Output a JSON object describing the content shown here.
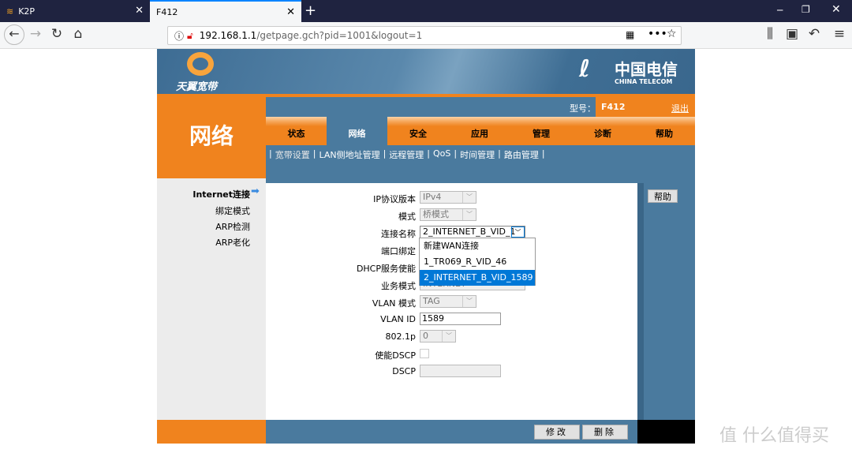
{
  "browser": {
    "tabs": [
      {
        "label": "K2P"
      },
      {
        "label": "F412",
        "active": true
      }
    ],
    "url_host": "192.168.1.1",
    "url_path": "/getpage.gch?pid=1001&logout=1"
  },
  "header": {
    "left_logo": "天翼宽带",
    "right_logo_cn": "中国电信",
    "right_logo_en": "CHINA TELECOM",
    "section_title": "网络",
    "model_label": "型号：",
    "model_value": "F412",
    "logout": "退出"
  },
  "tabs": [
    {
      "label": "状态"
    },
    {
      "label": "网络",
      "active": true
    },
    {
      "label": "安全"
    },
    {
      "label": "应用"
    },
    {
      "label": "管理"
    },
    {
      "label": "诊断"
    },
    {
      "label": "帮助"
    }
  ],
  "submenu": [
    "宽带设置",
    "LAN侧地址管理",
    "远程管理",
    "QoS",
    "时间管理",
    "路由管理"
  ],
  "sidebar": [
    {
      "label": "Internet连接",
      "active": true
    },
    {
      "label": "绑定模式"
    },
    {
      "label": "ARP检测"
    },
    {
      "label": "ARP老化"
    }
  ],
  "form": {
    "ip_version": {
      "label": "IP协议版本",
      "value": "IPv4"
    },
    "mode": {
      "label": "模式",
      "value": "桥模式"
    },
    "conn_name": {
      "label": "连接名称",
      "value": "2_INTERNET_B_VID_1",
      "options": [
        "新建WAN连接",
        "1_TR069_R_VID_46",
        "2_INTERNET_B_VID_1589"
      ],
      "selected_index": 2
    },
    "port_bind": {
      "label": "端口绑定"
    },
    "dhcp": {
      "label": "DHCP服务使能"
    },
    "service_mode": {
      "label": "业务模式",
      "value": "INTERNET"
    },
    "vlan_mode": {
      "label": "VLAN 模式",
      "value": "TAG"
    },
    "vlan_id": {
      "label": "VLAN ID",
      "value": "1589"
    },
    "p8021": {
      "label": "802.1p",
      "value": "0"
    },
    "dscp_enable": {
      "label": "使能DSCP",
      "checked": false
    },
    "dscp": {
      "label": "DSCP",
      "value": ""
    }
  },
  "help_button": "帮助",
  "modify_button": "修改",
  "delete_button": "删除",
  "watermark": "值 什么值得买",
  "colors": {
    "orange": "#f0831e",
    "blue": "#4a7a9e",
    "highlight": "#0078d7"
  }
}
